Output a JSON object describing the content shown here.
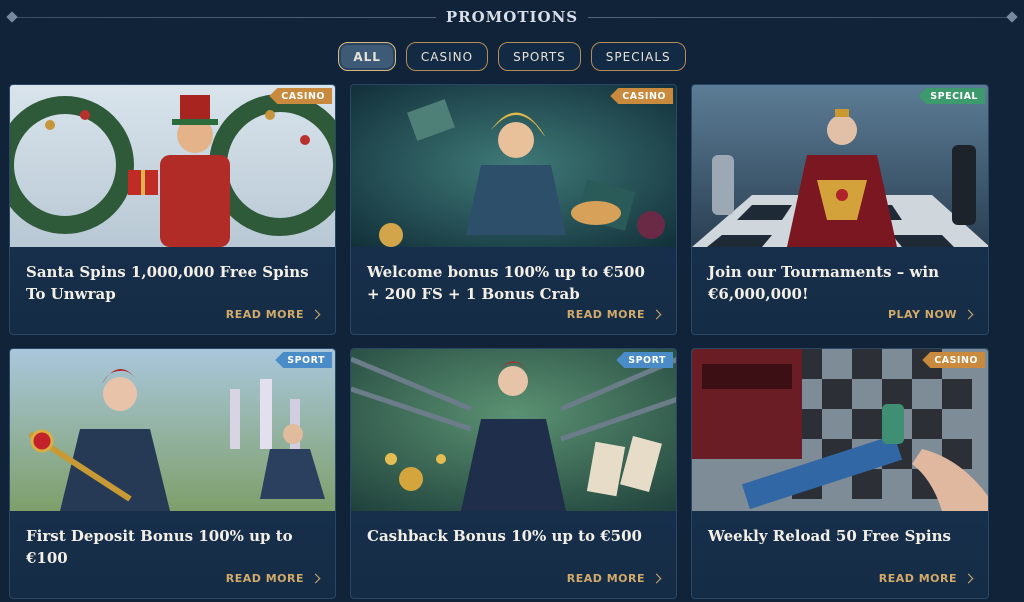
{
  "page": {
    "title": "PROMOTIONS"
  },
  "filters": [
    {
      "label": "ALL",
      "active": true
    },
    {
      "label": "CASINO",
      "active": false
    },
    {
      "label": "SPORTS",
      "active": false
    },
    {
      "label": "SPECIALS",
      "active": false
    }
  ],
  "colors": {
    "background": "#112338",
    "casino_tag": "#c98a3e",
    "special_tag": "#3c9a6c",
    "sport_tag": "#4a8cc8",
    "cta": "#d2aa6a"
  },
  "promotions": [
    {
      "tag": "CASINO",
      "title": "Santa Spins 1,000,000 Free Spins To Unwrap",
      "cta": "READ MORE"
    },
    {
      "tag": "CASINO",
      "title": "Welcome bonus 100% up to €500 + 200 FS + 1 Bonus Crab",
      "cta": "READ MORE"
    },
    {
      "tag": "SPECIAL",
      "title": "Join our Tournaments – win €6,000,000!",
      "cta": "PLAY NOW"
    },
    {
      "tag": "SPORT",
      "title": "First Deposit Bonus 100% up to €100",
      "cta": "READ MORE"
    },
    {
      "tag": "SPORT",
      "title": "Cashback Bonus 10% up to €500",
      "cta": "READ MORE"
    },
    {
      "tag": "CASINO",
      "title": "Weekly Reload 50 Free Spins",
      "cta": "READ MORE"
    }
  ],
  "icons": {
    "cta_arrow": "chevron-right-icon",
    "rule_ornament": "diamond-icon"
  }
}
